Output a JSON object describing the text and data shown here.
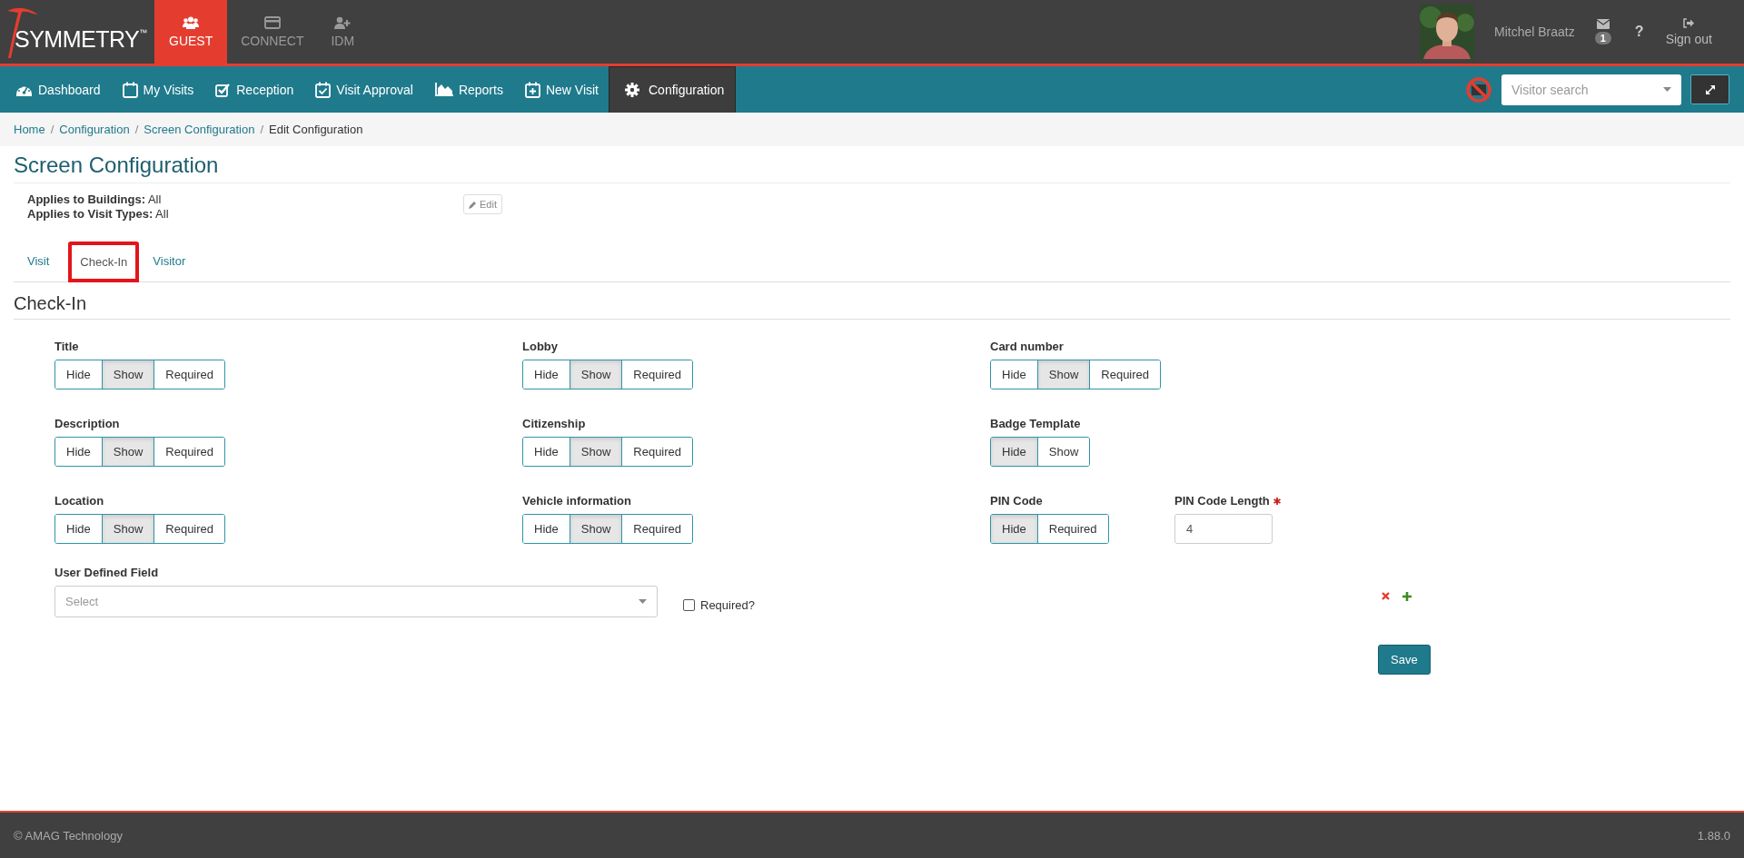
{
  "brand": {
    "logo": "SYMMETRY",
    "trademark": "™"
  },
  "apps": [
    {
      "label": "GUEST",
      "selected": true
    },
    {
      "label": "CONNECT",
      "selected": false
    },
    {
      "label": "IDM",
      "selected": false
    }
  ],
  "user": {
    "name": "Mitchel Braatz",
    "message_count": "1",
    "help": "?",
    "sign_out": "Sign out"
  },
  "nav": [
    {
      "label": "Dashboard",
      "selected": false
    },
    {
      "label": "My Visits",
      "selected": false
    },
    {
      "label": "Reception",
      "selected": false
    },
    {
      "label": "Visit Approval",
      "selected": false
    },
    {
      "label": "Reports",
      "selected": false
    },
    {
      "label": "New Visit",
      "selected": false
    },
    {
      "label": "Configuration",
      "selected": true
    }
  ],
  "visitor_search": {
    "placeholder": "Visitor search"
  },
  "breadcrumb": [
    {
      "label": "Home"
    },
    {
      "separator": "/",
      "label": "Configuration"
    },
    {
      "separator": "/",
      "label": "Screen Configuration"
    },
    {
      "separator": "/",
      "label": "Edit Configuration"
    }
  ],
  "page_title": "Screen Configuration",
  "applies": [
    {
      "label": "Applies to Buildings:",
      "value": "All"
    },
    {
      "label": "Applies to Visit Types:",
      "value": "All"
    }
  ],
  "edit_button": "Edit",
  "tabs": [
    {
      "label": "Visit",
      "selected": false,
      "highlighted": false
    },
    {
      "label": "Check-In",
      "selected": true,
      "highlighted": true
    },
    {
      "label": "Visitor",
      "selected": false,
      "highlighted": false
    }
  ],
  "section_title": "Check-In",
  "rows": [
    {
      "fields": [
        {
          "kind": "toggle",
          "label": "Title",
          "options": [
            {
              "label": "Hide",
              "selected": false
            },
            {
              "label": "Show",
              "selected": true
            },
            {
              "label": "Required",
              "selected": false
            }
          ]
        },
        {
          "kind": "toggle",
          "label": "Lobby",
          "options": [
            {
              "label": "Hide",
              "selected": false
            },
            {
              "label": "Show",
              "selected": true
            },
            {
              "label": "Required",
              "selected": false
            }
          ]
        },
        {
          "kind": "toggle",
          "label": "Card number",
          "options": [
            {
              "label": "Hide",
              "selected": false
            },
            {
              "label": "Show",
              "selected": true
            },
            {
              "label": "Required",
              "selected": false
            }
          ]
        }
      ]
    },
    {
      "fields": [
        {
          "kind": "toggle",
          "label": "Description",
          "options": [
            {
              "label": "Hide",
              "selected": false
            },
            {
              "label": "Show",
              "selected": true
            },
            {
              "label": "Required",
              "selected": false
            }
          ]
        },
        {
          "kind": "toggle",
          "label": "Citizenship",
          "options": [
            {
              "label": "Hide",
              "selected": false
            },
            {
              "label": "Show",
              "selected": true
            },
            {
              "label": "Required",
              "selected": false
            }
          ]
        },
        {
          "kind": "toggle",
          "label": "Badge Template",
          "options": [
            {
              "label": "Hide",
              "selected": true
            },
            {
              "label": "Show",
              "selected": false
            }
          ]
        }
      ]
    },
    {
      "fields": [
        {
          "kind": "toggle",
          "label": "Location",
          "options": [
            {
              "label": "Hide",
              "selected": false
            },
            {
              "label": "Show",
              "selected": true
            },
            {
              "label": "Required",
              "selected": false
            }
          ]
        },
        {
          "kind": "toggle",
          "label": "Vehicle information",
          "options": [
            {
              "label": "Hide",
              "selected": false
            },
            {
              "label": "Show",
              "selected": true
            },
            {
              "label": "Required",
              "selected": false
            }
          ]
        },
        {
          "kind": "toggle",
          "label": "PIN Code",
          "options": [
            {
              "label": "Hide",
              "selected": true
            },
            {
              "label": "Required",
              "selected": false
            }
          ]
        },
        {
          "kind": "number",
          "label": "PIN Code Length",
          "required": true,
          "value": "4"
        }
      ]
    }
  ],
  "user_defined_field": {
    "label": "User Defined Field",
    "placeholder": "Select",
    "required_label": "Required?",
    "required_checked": false
  },
  "save_button": "Save",
  "footer": {
    "copyright": "© AMAG Technology",
    "version": "1.88.0"
  }
}
